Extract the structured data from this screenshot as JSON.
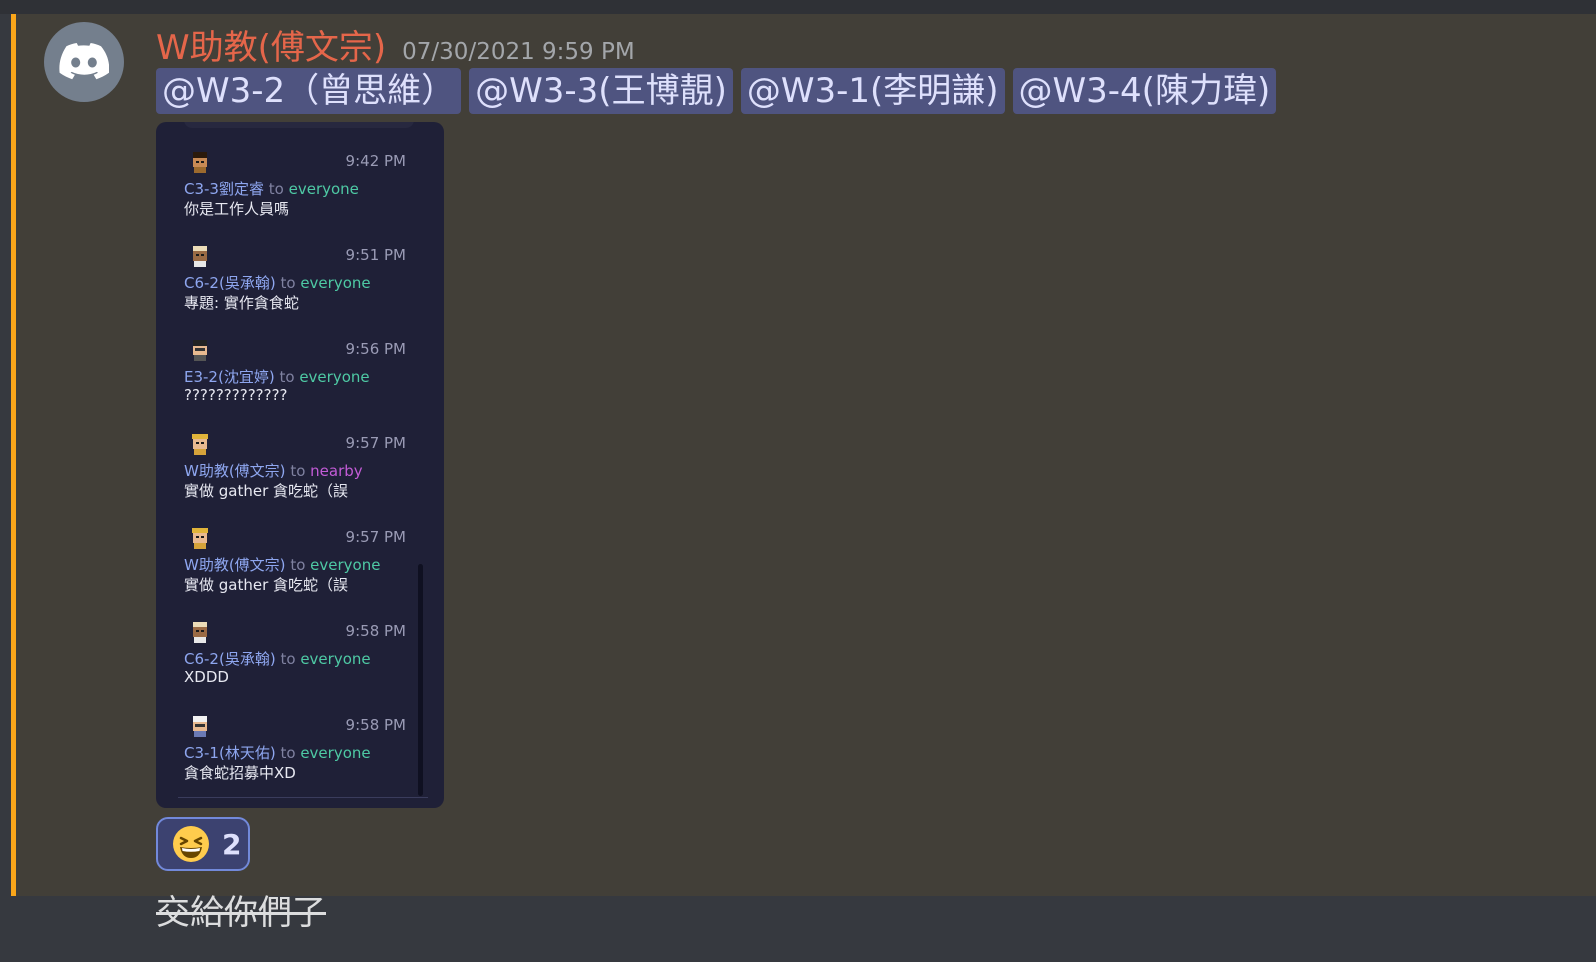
{
  "message": {
    "author": "W助教(傅文宗)",
    "timestamp": "07/30/2021 9:59 PM",
    "author_color": "#e5664a",
    "highlight_color": "#faa61a",
    "mentions": [
      "@W3-2（曾思維）",
      "@W3-3(王博靚)",
      "@W3-1(李明謙)",
      "@W3-4(陳力瑋)"
    ],
    "attachment": {
      "to_word": "to",
      "chat": [
        {
          "time": "9:42 PM",
          "sender": "C3-3劉定睿",
          "target": "everyone",
          "text": "你是工作人員嗎"
        },
        {
          "time": "9:51 PM",
          "sender": "C6-2(吳承翰)",
          "target": "everyone",
          "text": "專題: 實作貪食蛇"
        },
        {
          "time": "9:56 PM",
          "sender": "E3-2(沈宜婷)",
          "target": "everyone",
          "text": "?????????????"
        },
        {
          "time": "9:57 PM",
          "sender": "W助教(傅文宗)",
          "target": "nearby",
          "text": "實做 gather 貪吃蛇（誤"
        },
        {
          "time": "9:57 PM",
          "sender": "W助教(傅文宗)",
          "target": "everyone",
          "text": "實做 gather 貪吃蛇（誤"
        },
        {
          "time": "9:58 PM",
          "sender": "C6-2(吳承翰)",
          "target": "everyone",
          "text": "XDDD"
        },
        {
          "time": "9:58 PM",
          "sender": "C3-1(林天佑)",
          "target": "everyone",
          "text": "貪食蛇招募中XD"
        }
      ]
    },
    "reaction": {
      "emoji": "laughing-face-icon",
      "count": "2"
    }
  },
  "next_message": {
    "text": "交給你們了"
  }
}
